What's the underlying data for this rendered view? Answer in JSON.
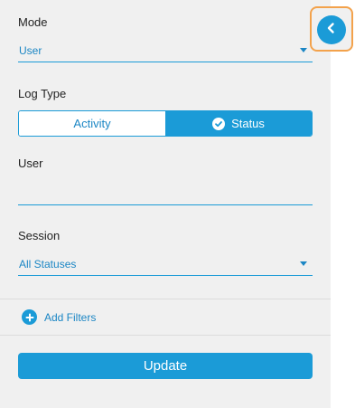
{
  "mode": {
    "label": "Mode",
    "selected": "User"
  },
  "log_type": {
    "label": "Log Type",
    "options": [
      "Activity",
      "Status"
    ],
    "active": "Status"
  },
  "user": {
    "label": "User",
    "value": "",
    "placeholder": ""
  },
  "session": {
    "label": "Session",
    "selected": "All Statuses"
  },
  "filters": {
    "add_label": "Add Filters"
  },
  "actions": {
    "update_label": "Update"
  },
  "colors": {
    "accent": "#1b9bd7",
    "panel_bg": "#f0f0f0",
    "highlight_border": "#f3a24b"
  },
  "icons": {
    "collapse": "chevron-left-icon",
    "check": "check-circle-icon",
    "add": "plus-circle-icon",
    "dropdown": "caret-down-icon"
  }
}
